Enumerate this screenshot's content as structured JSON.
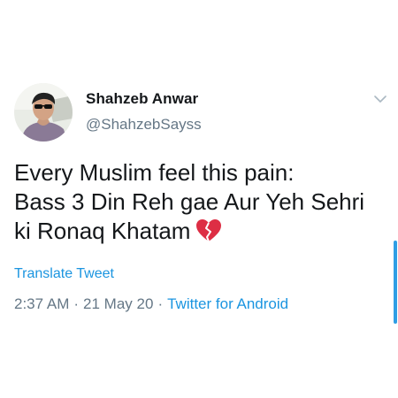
{
  "user": {
    "name": "Shahzeb Anwar",
    "handle": "@ShahzebSayss"
  },
  "tweet": {
    "lines": [
      "Every Muslim feel this pain:",
      "Bass 3 Din Reh gae Aur Yeh Sehri",
      "ki Ronaq Khatam"
    ],
    "emoji": "broken-heart-icon",
    "translate_label": "Translate Tweet",
    "time": "2:37 AM",
    "date": "21 May 20",
    "separator": "·",
    "source": "Twitter for Android"
  },
  "colors": {
    "link": "#1b95e0",
    "muted": "#657786",
    "text": "#14171a",
    "heart": "#dd2e44"
  }
}
